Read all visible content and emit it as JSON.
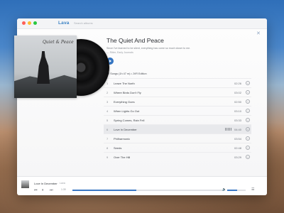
{
  "app": {
    "name": "Lava",
    "search_placeholder": "Search albums"
  },
  "album": {
    "title": "The Quiet And Peace",
    "description": "Since I've learned to be silent, everything has come so much closer to me.",
    "credit": "— Ritter, Early Journals",
    "meta": "12 Songs (1h 47 m)  •  JVR Edition",
    "cover_script": "Quiet & Peace"
  },
  "tracks": [
    {
      "num": "1",
      "name": "Leave The North",
      "duration": "02:26",
      "active": false
    },
    {
      "num": "2",
      "name": "Where Birds Don't Fly",
      "duration": "03:02",
      "active": false
    },
    {
      "num": "3",
      "name": "Everything Goes",
      "duration": "02:50",
      "active": false
    },
    {
      "num": "4",
      "name": "When Lights Go Out",
      "duration": "03:10",
      "active": false
    },
    {
      "num": "5",
      "name": "Spring Comes, Rain Fell",
      "duration": "03:33",
      "active": false
    },
    {
      "num": "6",
      "name": "Love In December",
      "duration": "04:40",
      "active": true
    },
    {
      "num": "7",
      "name": "Philharmonic",
      "duration": "03:54",
      "active": false
    },
    {
      "num": "8",
      "name": "Seeds",
      "duration": "02:48",
      "active": false
    },
    {
      "num": "9",
      "name": "Over The Hill",
      "duration": "03:29",
      "active": false
    }
  ],
  "player": {
    "now_playing": "Love In December",
    "artist": "Lava",
    "elapsed": "1:39",
    "progress": 0.42,
    "volume": 0.55
  },
  "icons": {
    "close": "close-icon",
    "add": "plus-circle-icon",
    "waveform": "waveform-icon"
  },
  "colors": {
    "accent": "#3575c2",
    "active_row": "#e8e9ec"
  }
}
